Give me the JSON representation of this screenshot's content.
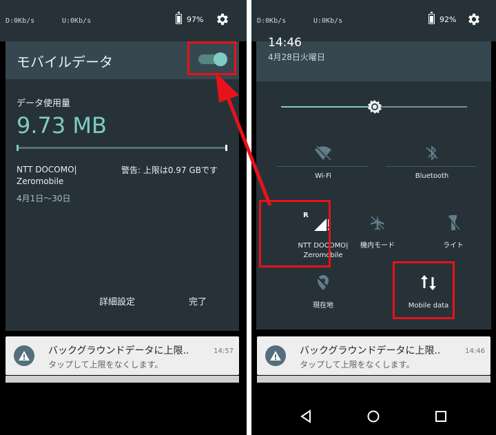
{
  "left": {
    "status": {
      "down": "D:0Kb/s",
      "up": "U:0Kb/s",
      "battery": "97%"
    },
    "title": "モバイルデータ",
    "toggle_on": true,
    "usage_label": "データ使用量",
    "usage_value": "9.73 MB",
    "carrier_line1": "NTT DOCOMO|",
    "carrier_line2": "Zeromobile",
    "warning": "警告: 上限は0.97 GBです",
    "range": "4月1日〜30日",
    "settings_button": "詳細設定",
    "done_button": "完了",
    "notification": {
      "title": "バックグラウンドデータに上限..",
      "subtitle": "タップして上限をなくします。",
      "time": "14:57"
    }
  },
  "right": {
    "status": {
      "down": "D:0Kb/s",
      "up": "U:0Kb/s",
      "battery": "92%"
    },
    "time": "14:46",
    "date": "4月28日火曜日",
    "tiles": {
      "wifi": "Wi-Fi",
      "bluetooth": "Bluetooth",
      "carrier_line1": "NTT DOCOMO|",
      "carrier_line2": "Zeromobile",
      "airplane": "機内モード",
      "flashlight": "ライト",
      "location": "現在地",
      "mobile_data": "Mobile data"
    },
    "carrier_roaming_badge": "R",
    "notification": {
      "title": "バックグラウンドデータに上限..",
      "subtitle": "タップして上限をなくします。",
      "time": "14:46"
    }
  },
  "colors": {
    "accent": "#80cbc4",
    "shade_header": "#37474f",
    "shade_body": "#263238",
    "highlight": "#e8121b"
  },
  "icons": [
    "gear-icon",
    "battery-icon",
    "sun-icon",
    "wifi-off-icon",
    "bluetooth-off-icon",
    "signal-icon",
    "airplane-icon",
    "flashlight-icon",
    "location-off-icon",
    "mobile-data-icon",
    "warning-icon",
    "back-icon",
    "home-icon",
    "recents-icon"
  ]
}
